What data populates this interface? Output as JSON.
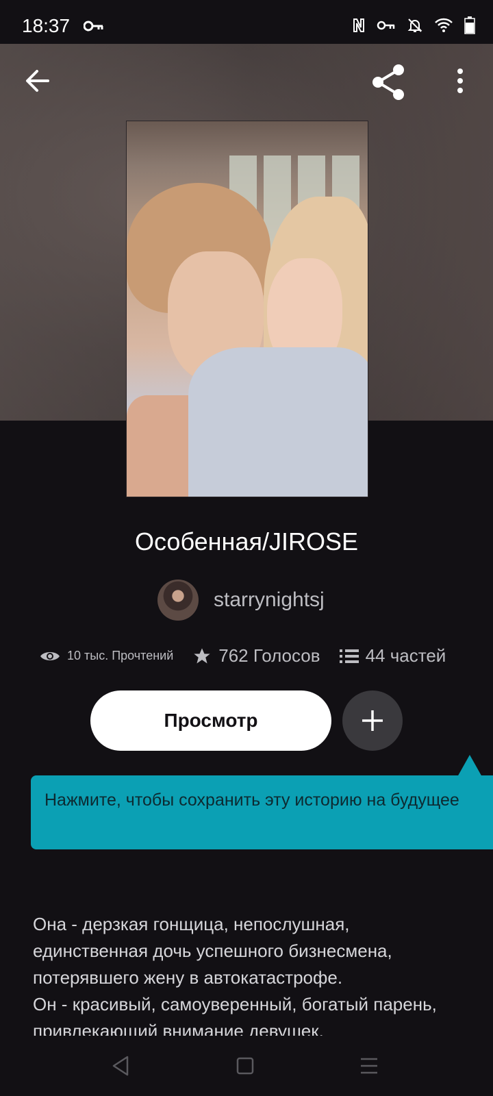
{
  "status_bar": {
    "time": "18:37",
    "icons": [
      "key-icon",
      "nfc-icon",
      "vpn-key-icon",
      "bell-off-icon",
      "wifi-icon",
      "battery-icon"
    ]
  },
  "topbar": {
    "icons": [
      "back-arrow-icon",
      "share-icon",
      "more-vertical-icon"
    ]
  },
  "story": {
    "title": "Особенная/JIROSE",
    "author": "starrynightsj",
    "stats": {
      "reads": "10 тыс. Прочтений",
      "votes": "762 Голосов",
      "parts": "44 частей"
    },
    "read_button": "Просмотр",
    "tooltip": "Нажмите, чтобы сохранить эту историю на будущее",
    "description": "Она - дерзкая гонщица, непослушная, единственная дочь успешного бизнесмена, потерявшего жену в автокатастрофе.\nОн - красивый, самоуверенный, богатый парень, привлекающий внимание девушек."
  },
  "colors": {
    "background": "#121014",
    "tooltip": "#0ba0b4",
    "secondary_text": "#bdbdc2"
  },
  "navbar": {
    "icons": [
      "nav-back-icon",
      "nav-home-icon",
      "nav-menu-icon"
    ]
  }
}
